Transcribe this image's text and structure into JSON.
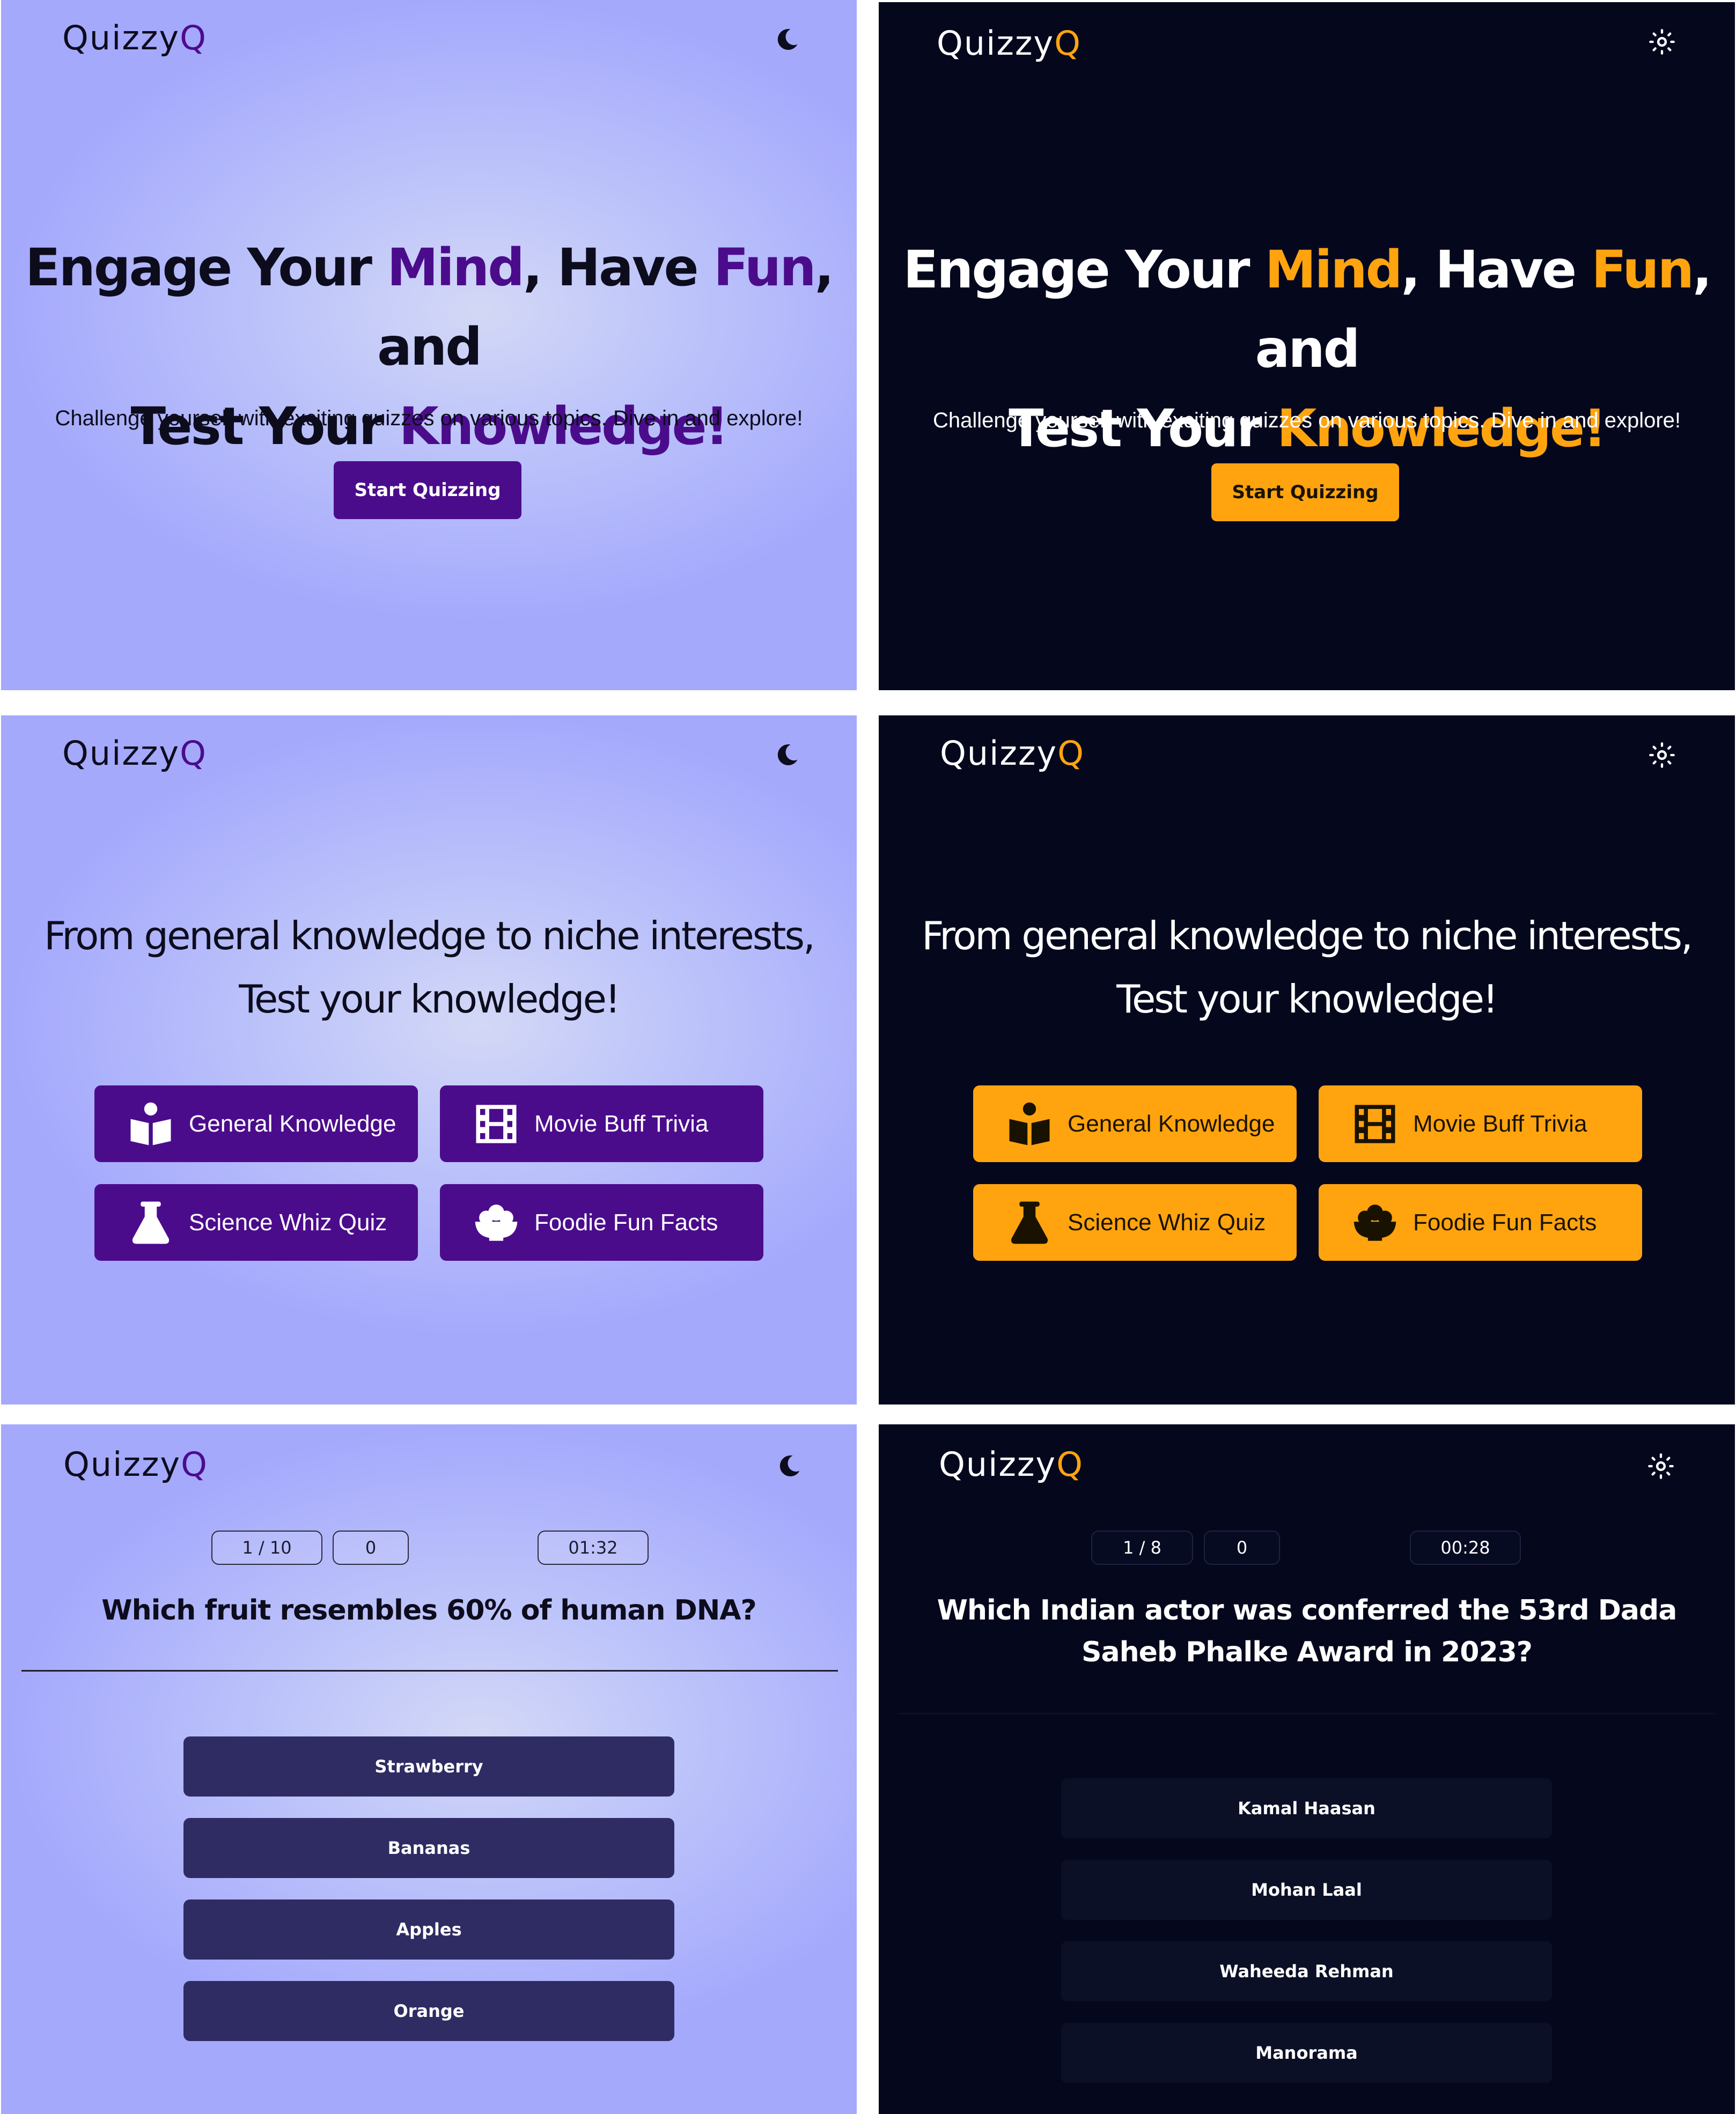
{
  "app": {
    "logo_main": "Quizzy",
    "logo_accent": "Q"
  },
  "colors": {
    "light_accent": "#4b0c8c",
    "dark_accent": "#ffa40f",
    "dark_background": "#05081d",
    "light_answer_button": "#2e2c63"
  },
  "icons": {
    "light_theme_toggle": "moon-icon",
    "dark_theme_toggle": "sun-icon"
  },
  "hero": {
    "title_part1": "Engage Your ",
    "title_mind": "Mind",
    "title_part2": ", Have ",
    "title_fun": "Fun",
    "title_part3": ", and",
    "title_part4": "Test Your ",
    "title_knowledge": "Knowledge!",
    "subtitle": "Challenge yourself with exciting quizzes on various topics. Dive in and explore!",
    "cta_label": "Start Quizzing"
  },
  "categories": {
    "title": "From general knowledge to niche interests, Test your knowledge!",
    "items": [
      {
        "label": "General Knowledge",
        "icon": "book-reader-icon"
      },
      {
        "label": "Movie Buff Trivia",
        "icon": "film-icon"
      },
      {
        "label": "Science Whiz Quiz",
        "icon": "flask-icon"
      },
      {
        "label": "Foodie Fun Facts",
        "icon": "food-bowl-icon"
      }
    ]
  },
  "quiz_light": {
    "progress": "1 / 10",
    "score": "0",
    "timer": "01:32",
    "question": "Which fruit resembles 60% of human DNA?",
    "answers": [
      "Strawberry",
      "Bananas",
      "Apples",
      "Orange"
    ]
  },
  "quiz_dark": {
    "progress": "1 / 8",
    "score": "0",
    "timer": "00:28",
    "question": "Which Indian actor was conferred the 53rd Dada Saheb Phalke Award in 2023?",
    "answers": [
      "Kamal Haasan",
      "Mohan Laal",
      "Waheeda Rehman",
      "Manorama"
    ]
  }
}
